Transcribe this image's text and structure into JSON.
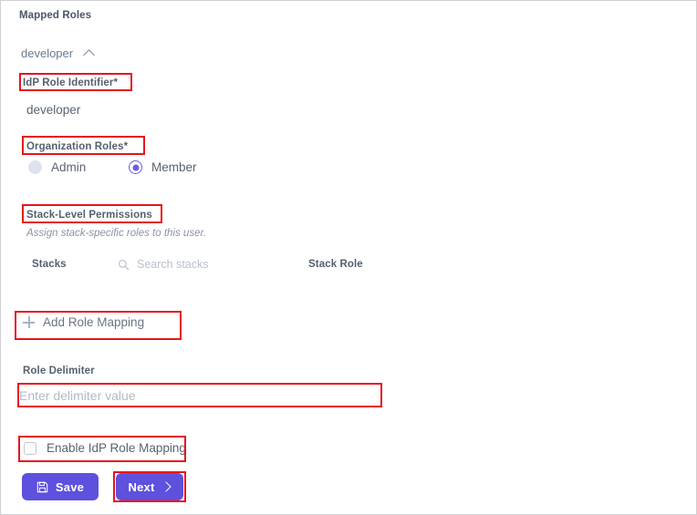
{
  "page": {
    "section_title": "Mapped Roles",
    "border_color": "#cfd0d2",
    "annotation_color": "#e8141b",
    "accent_color": "#6c5ce7"
  },
  "accordion": {
    "label": "developer",
    "chevron_icon": "chevron-up-icon",
    "expanded": true
  },
  "idp_role": {
    "label": "IdP Role Identifier*",
    "value": "developer"
  },
  "organization_roles": {
    "label": "Organization Roles*",
    "options": [
      {
        "label": "Admin",
        "selected": false
      },
      {
        "label": "Member",
        "selected": true
      }
    ]
  },
  "stack_permissions": {
    "label": "Stack-Level Permissions",
    "description": "Assign stack-specific roles to this user.",
    "columns": {
      "stacks": "Stacks",
      "stack_role": "Stack Role"
    },
    "search": {
      "icon": "search-icon",
      "placeholder": "Search stacks",
      "value": ""
    },
    "rows": []
  },
  "add_role_mapping": {
    "icon": "plus-icon",
    "label": "Add Role Mapping"
  },
  "role_delimiter": {
    "label": "Role Delimiter",
    "placeholder": "Enter delimiter value",
    "value": ""
  },
  "enable_idp_role_mapping": {
    "label": "Enable IdP Role Mapping",
    "checked": false
  },
  "footer": {
    "save": {
      "label": "Save",
      "icon": "save-disk-icon",
      "color": "#5d51dd"
    },
    "next": {
      "label": "Next",
      "icon": "chevron-right-icon",
      "color": "#5d51dd"
    }
  }
}
